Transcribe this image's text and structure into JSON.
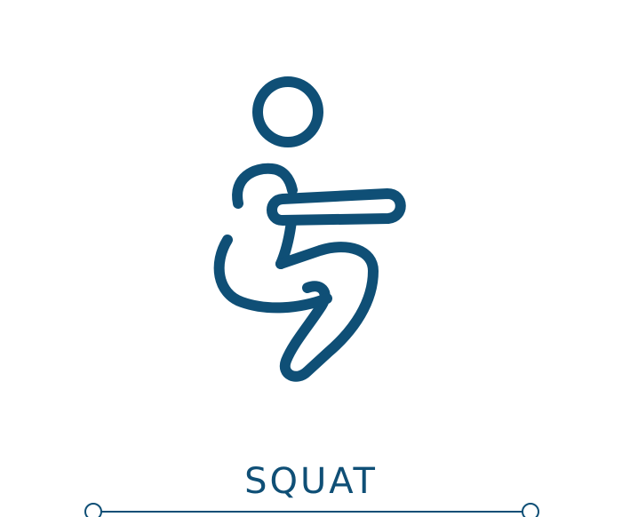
{
  "icon": {
    "name": "squat-exercise-icon",
    "stroke_color": "#0f4f76"
  },
  "caption": {
    "text": "SQUAT"
  },
  "colors": {
    "background": "#ffffff",
    "accent": "#0f4f76"
  }
}
